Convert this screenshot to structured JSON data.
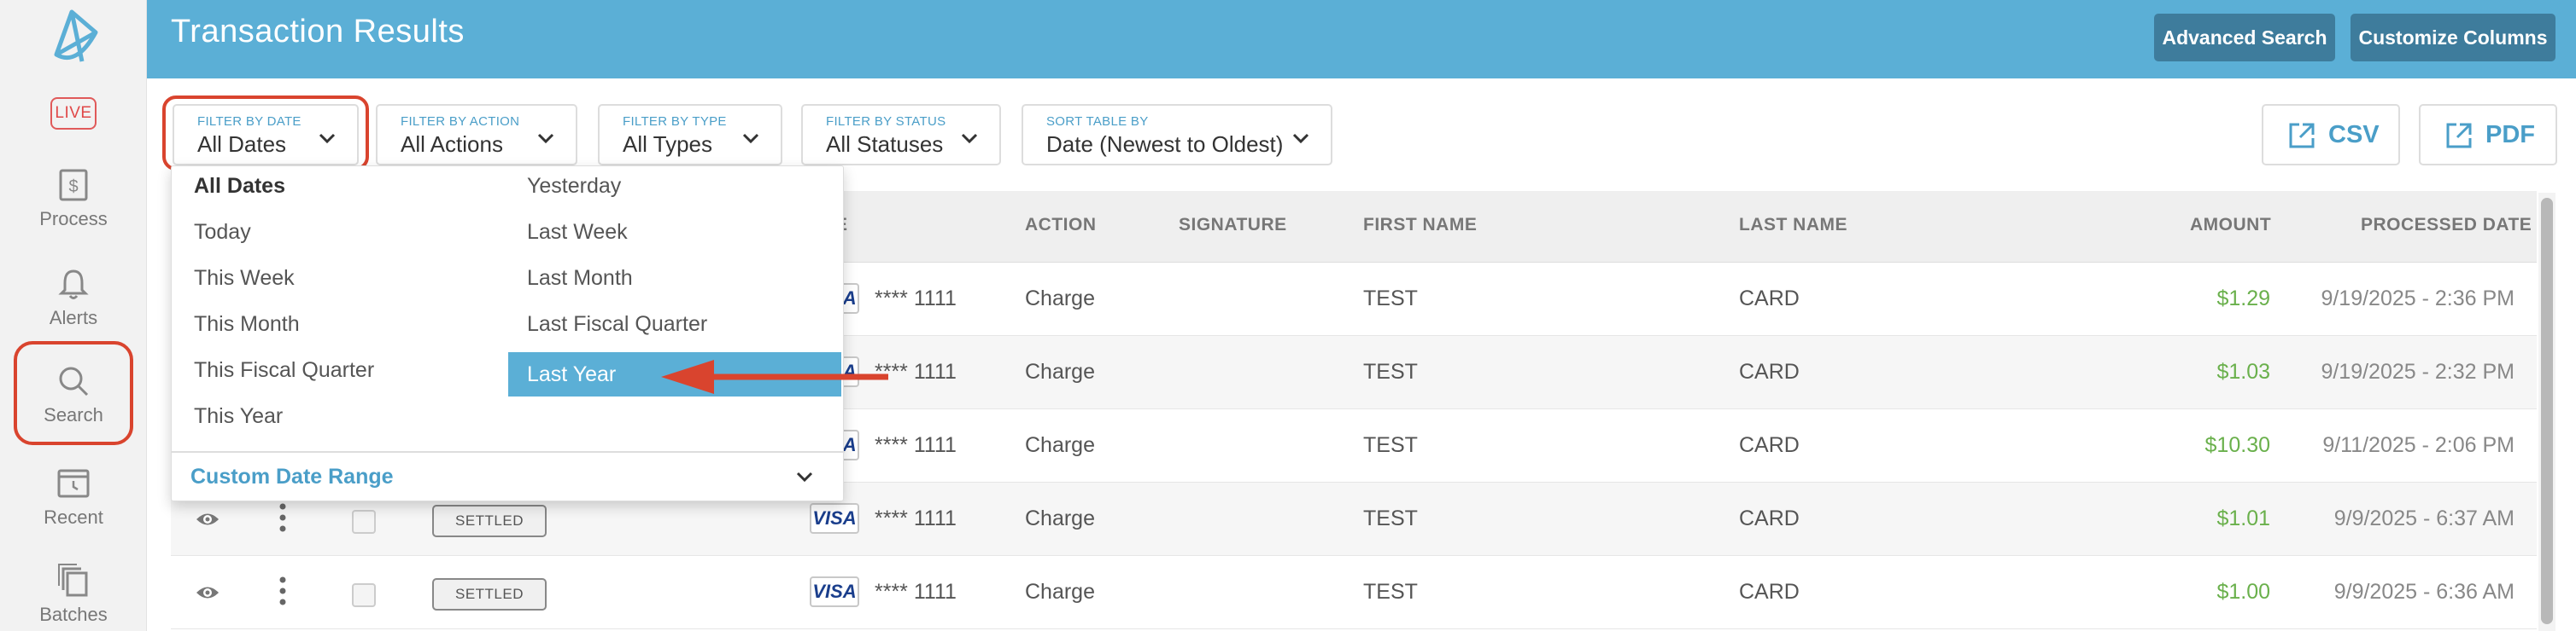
{
  "app": {
    "title": "Transaction Results",
    "live_badge": "LIVE"
  },
  "sidebar": {
    "items": [
      {
        "label": "Process",
        "icon": "dollar-receipt-icon"
      },
      {
        "label": "Alerts",
        "icon": "bell-icon"
      },
      {
        "label": "Search",
        "icon": "search-icon",
        "active": true
      },
      {
        "label": "Recent",
        "icon": "calendar-clock-icon"
      },
      {
        "label": "Batches",
        "icon": "stacked-pages-icon"
      }
    ]
  },
  "header": {
    "advanced_search": "Advanced Search",
    "customize_columns": "Customize Columns"
  },
  "filters": {
    "date": {
      "label": "FILTER BY DATE",
      "value": "All Dates"
    },
    "action": {
      "label": "FILTER BY ACTION",
      "value": "All Actions"
    },
    "type": {
      "label": "FILTER BY TYPE",
      "value": "All Types"
    },
    "status": {
      "label": "FILTER BY STATUS",
      "value": "All Statuses"
    },
    "sort": {
      "label": "SORT TABLE BY",
      "value": "Date (Newest to Oldest)"
    }
  },
  "export": {
    "csv": "CSV",
    "pdf": "PDF"
  },
  "date_dropdown": {
    "left_options": [
      "All Dates",
      "Today",
      "This Week",
      "This Month",
      "This Fiscal Quarter",
      "This Year"
    ],
    "right_options": [
      "Yesterday",
      "Last Week",
      "Last Month",
      "Last Fiscal Quarter",
      "Last Year"
    ],
    "selected": "All Dates",
    "highlighted": "Last Year",
    "custom_range": "Custom Date Range"
  },
  "table": {
    "columns": {
      "type_partial": "E",
      "action": "ACTION",
      "signature": "SIGNATURE",
      "first_name": "FIRST NAME",
      "last_name": "LAST NAME",
      "amount": "AMOUNT",
      "processed_date": "PROCESSED DATE"
    },
    "rows": [
      {
        "status": "",
        "card_brand": "VISA",
        "card": "**** 1111",
        "action": "Charge",
        "first_name": "TEST",
        "last_name": "CARD",
        "amount": "$1.29",
        "date": "9/19/2025 - 2:36 PM"
      },
      {
        "status": "",
        "card_brand": "VISA",
        "card": "**** 1111",
        "action": "Charge",
        "first_name": "TEST",
        "last_name": "CARD",
        "amount": "$1.03",
        "date": "9/19/2025 - 2:32 PM"
      },
      {
        "status": "",
        "card_brand": "VISA",
        "card": "**** 1111",
        "action": "Charge",
        "first_name": "TEST",
        "last_name": "CARD",
        "amount": "$10.30",
        "date": "9/11/2025 - 2:06 PM"
      },
      {
        "status": "SETTLED",
        "card_brand": "VISA",
        "card": "**** 1111",
        "action": "Charge",
        "first_name": "TEST",
        "last_name": "CARD",
        "amount": "$1.01",
        "date": "9/9/2025 - 6:37 AM"
      },
      {
        "status": "SETTLED",
        "card_brand": "VISA",
        "card": "**** 1111",
        "action": "Charge",
        "first_name": "TEST",
        "last_name": "CARD",
        "amount": "$1.00",
        "date": "9/9/2025 - 6:36 AM"
      }
    ]
  },
  "colors": {
    "brand": "#5bafd6",
    "button_dark": "#3e7c9c",
    "amount": "#6ab04c",
    "annotation": "#d9442e"
  }
}
